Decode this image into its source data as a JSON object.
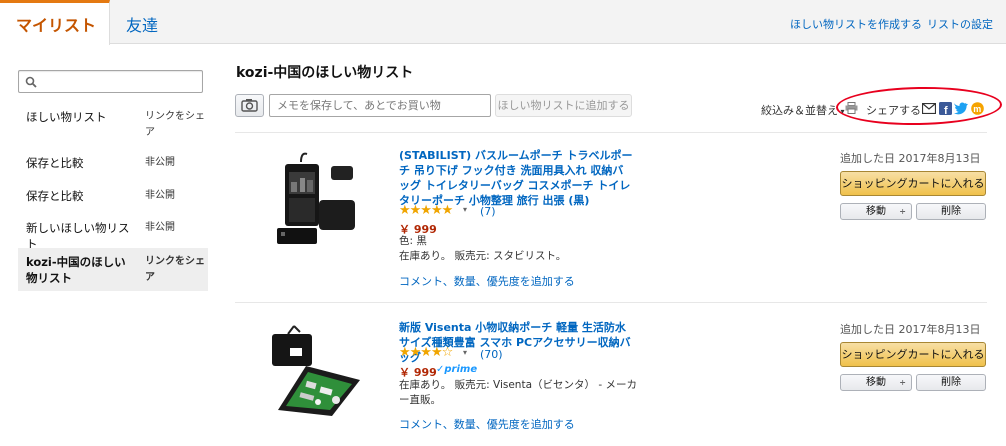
{
  "tabs": {
    "my_list": "マイリスト",
    "friends": "友達"
  },
  "top_links": {
    "create_list": "ほしい物リストを作成する",
    "list_settings": "リストの設定"
  },
  "sidebar": {
    "search_placeholder": "",
    "lists": [
      {
        "name": "ほしい物リスト",
        "privacy": "リンクをシェア"
      },
      {
        "name": "保存と比較",
        "privacy": "非公開"
      },
      {
        "name": "保存と比較",
        "privacy": "非公開"
      },
      {
        "name": "新しいほしい物リスト",
        "privacy": "非公開"
      },
      {
        "name": "kozi-中国のほしい物リスト",
        "privacy": "リンクをシェア"
      }
    ]
  },
  "main": {
    "title": "kozi-中国のほしい物リスト",
    "memo_placeholder": "メモを保存して、あとでお買い物",
    "add_button": "ほしい物リストに追加する",
    "filter_sort": "絞込み＆並替え",
    "share_label": "シェアする"
  },
  "items": [
    {
      "title": "(STABILIST) バスルームポーチ トラベルポーチ 吊り下げ フック付き 洗面用具入れ 収納バッグ トイレタリーバッグ コスメポーチ トイレタリーポーチ 小物整理 旅行 出張 (黒)",
      "stars": "★★★★★",
      "rating": 4.5,
      "review_count": "(7)",
      "price": "￥ 999",
      "prime": "",
      "color": "色: 黒",
      "availability": "在庫あり。 販売元: スタビリスト。",
      "comment_link": "コメント、数量、優先度を追加する",
      "added_date": "追加した日 2017年8月13日",
      "cart_button": "ショッピングカートに入れる",
      "move_button": "移動",
      "delete_button": "削除"
    },
    {
      "title": "新版 Visenta 小物収納ポーチ 軽量 生活防水 サイズ種類豊富 スマホ PCアクセサリー収納バッグ",
      "stars": "★★★★☆",
      "rating": 4.0,
      "review_count": "(70)",
      "price": "￥ 999",
      "prime": "✓prime",
      "color": "",
      "availability": "在庫あり。 販売元: Visenta（ビセンタ） - メーカー直販。",
      "comment_link": "コメント、数量、優先度を追加する",
      "added_date": "追加した日 2017年8月13日",
      "cart_button": "ショッピングカートに入れる",
      "move_button": "移動",
      "delete_button": "削除"
    }
  ]
}
